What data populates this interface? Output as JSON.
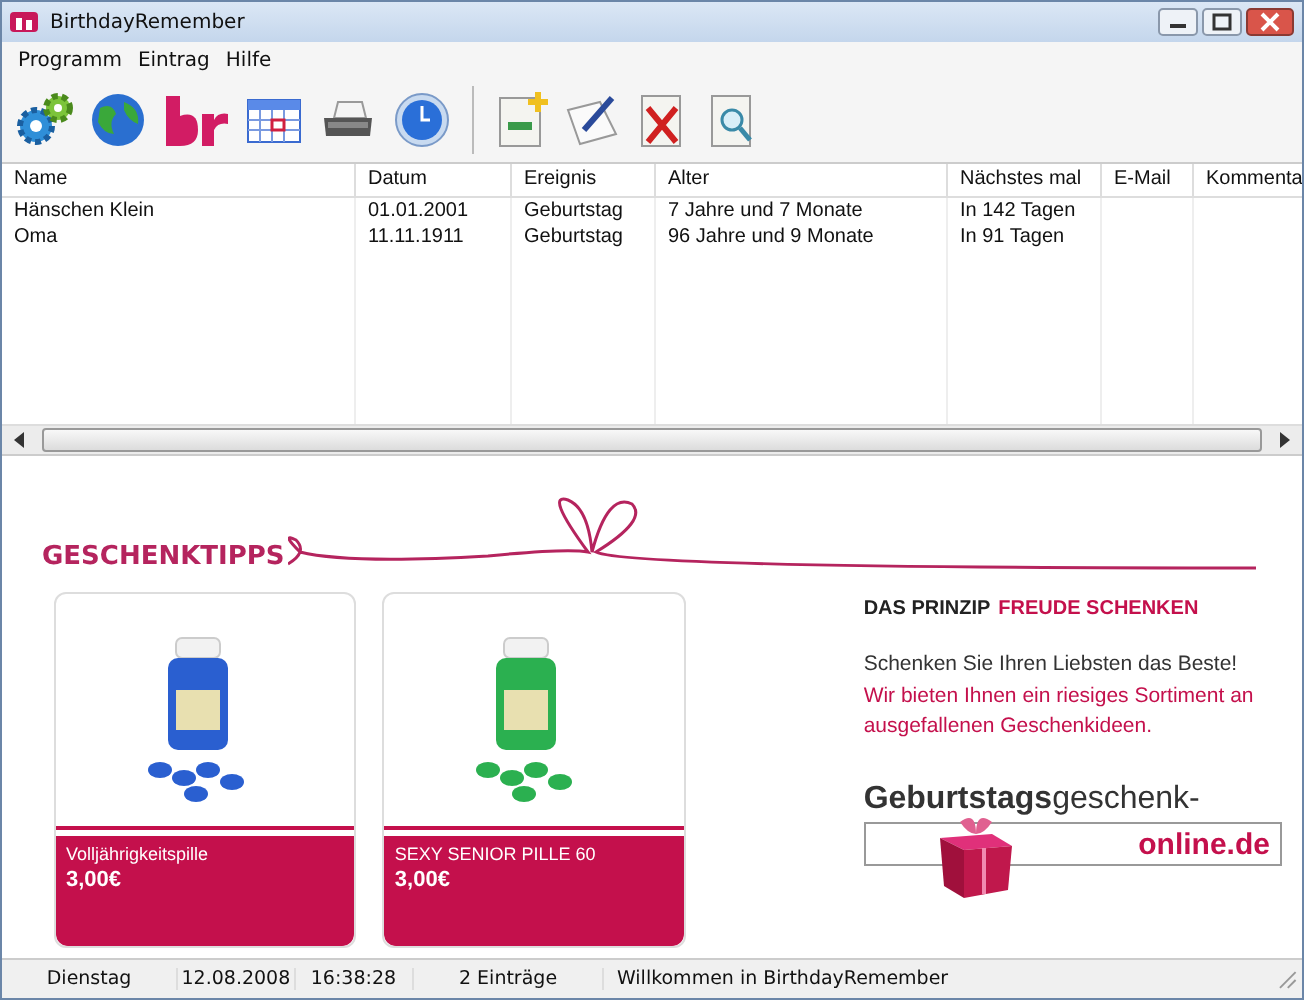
{
  "window": {
    "title": "BirthdayRemember"
  },
  "menu": [
    "Programm",
    "Eintrag",
    "Hilfe"
  ],
  "table": {
    "columns": [
      "Name",
      "Datum",
      "Ereignis",
      "Alter",
      "Nächstes mal",
      "E-Mail",
      "Kommenta"
    ],
    "rows": [
      {
        "cells": [
          "Hänschen Klein",
          "01.01.2001",
          "Geburtstag",
          "7 Jahre und 7 Monate",
          "In 142 Tagen"
        ]
      },
      {
        "cells": [
          "Oma",
          "11.11.1911",
          "Geburtstag",
          "96 Jahre und 9 Monate",
          "In 91 Tagen"
        ]
      }
    ]
  },
  "ad": {
    "heading": "GESCHENKTIPPS",
    "products": [
      {
        "name": "Volljährigkeitspille",
        "price": "3,00€",
        "kind": "picture"
      },
      {
        "name": "SEXY SENIOR PILLE 60",
        "price": "3,00€",
        "kind": "picture"
      }
    ],
    "tagline_lead": "DAS PRINZIP",
    "tagline_accent": "FREUDE SCHENKEN",
    "intro": "Schenken Sie Ihren Liebsten das Beste!",
    "offer": "Wir bieten Ihnen ein riesiges Sortiment an ausgefallenen Geschenkideen.",
    "logo_name": "**Geburtstags**geschenk-",
    "logo_domain": "online.de"
  },
  "status_bar": [
    "Dienstag",
    "12.08.2008",
    "16:38:28",
    "2 Einträge",
    "Willkommen in BirthdayRemember"
  ]
}
